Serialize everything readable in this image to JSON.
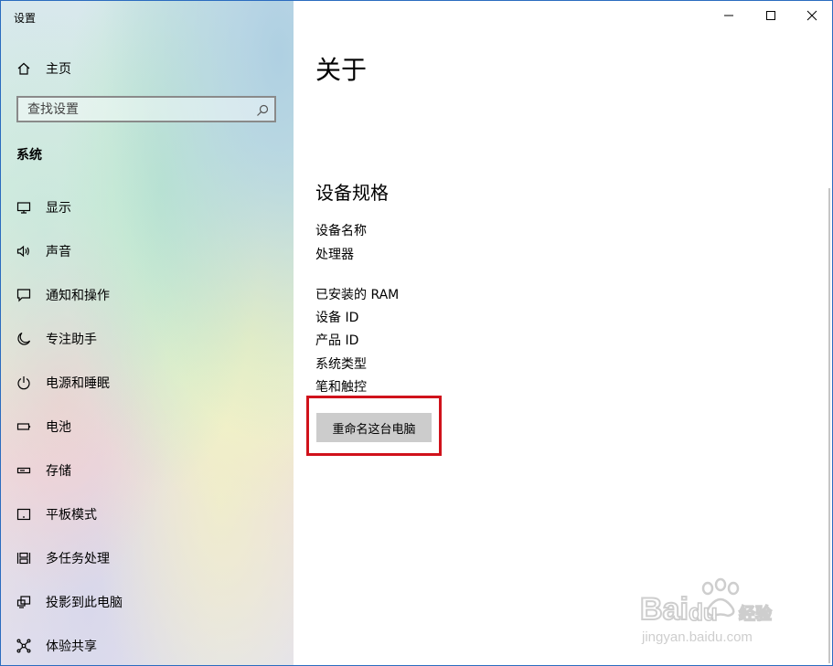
{
  "window": {
    "title": "设置"
  },
  "sidebar": {
    "home_label": "主页",
    "search_placeholder": "查找设置",
    "section_title": "系统",
    "items": [
      {
        "label": "显示",
        "icon": "monitor-icon"
      },
      {
        "label": "声音",
        "icon": "speaker-icon"
      },
      {
        "label": "通知和操作",
        "icon": "notification-icon"
      },
      {
        "label": "专注助手",
        "icon": "moon-icon"
      },
      {
        "label": "电源和睡眠",
        "icon": "power-icon"
      },
      {
        "label": "电池",
        "icon": "battery-icon"
      },
      {
        "label": "存储",
        "icon": "storage-icon"
      },
      {
        "label": "平板模式",
        "icon": "tablet-icon"
      },
      {
        "label": "多任务处理",
        "icon": "multitask-icon"
      },
      {
        "label": "投影到此电脑",
        "icon": "project-icon"
      },
      {
        "label": "体验共享",
        "icon": "share-icon"
      }
    ]
  },
  "main": {
    "page_title": "关于",
    "spec_heading": "设备规格",
    "spec_labels": [
      "设备名称",
      "处理器",
      "已安装的 RAM",
      "设备 ID",
      "产品 ID",
      "系统类型",
      "笔和触控"
    ],
    "rename_button": "重命名这台电脑"
  },
  "watermark": {
    "brand": "Bai",
    "brand_suffix": "du",
    "cn_text": "经验",
    "url": "jingyan.baidu.com"
  },
  "colors": {
    "highlight": "#d0121b",
    "window_border": "#2b6cbf",
    "button_bg": "#cccccc"
  }
}
